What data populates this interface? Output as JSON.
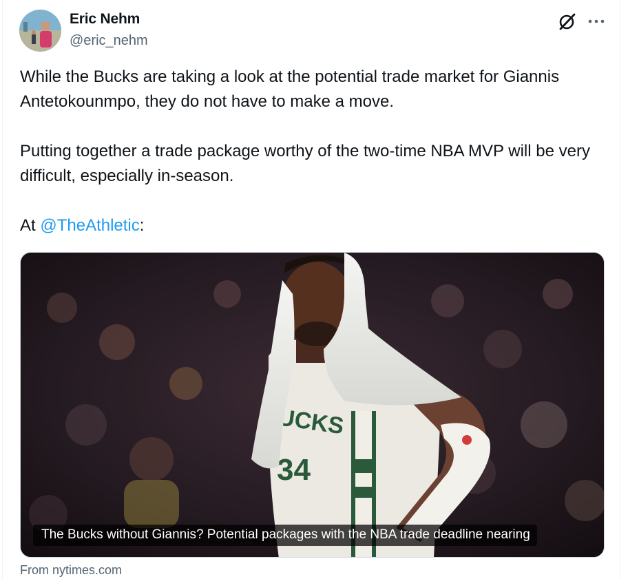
{
  "author": {
    "name": "Eric Nehm",
    "handle": "@eric_nehm"
  },
  "actions": {
    "grok_icon": "grok-icon",
    "more_icon": "more-icon"
  },
  "tweet": {
    "paragraph1": "While the Bucks are taking a look at the potential trade market for Giannis Antetokounmpo, they do not have to make a move.",
    "paragraph2": "Putting together a trade package worthy of the two-time NBA MVP will be very difficult, especially in-season.",
    "paragraph3_prefix": "At ",
    "mention": "@TheAthletic",
    "paragraph3_suffix": ":"
  },
  "link_card": {
    "headline": "The Bucks without Giannis? Potential packages with the NBA trade deadline nearing",
    "source": "From nytimes.com"
  },
  "colors": {
    "text_primary": "#0f1419",
    "text_secondary": "#536471",
    "link": "#1d9bf0",
    "border": "#cfd9de"
  }
}
